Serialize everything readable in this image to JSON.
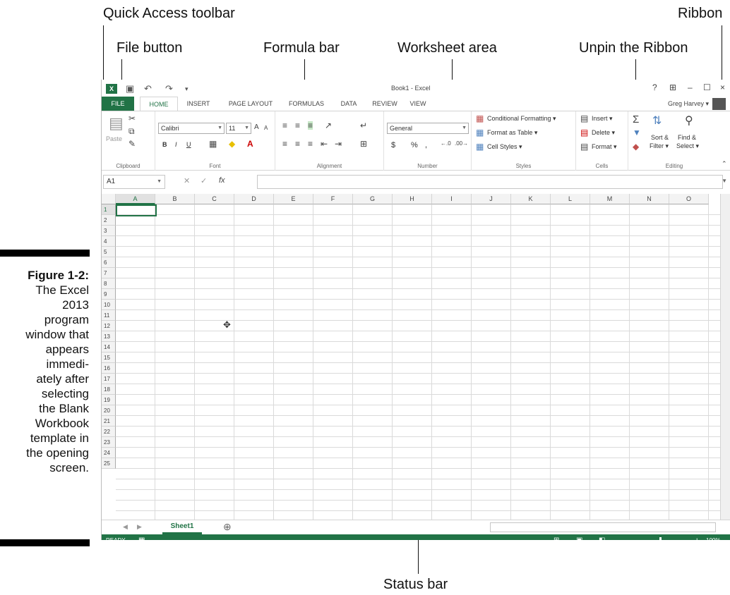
{
  "callouts": {
    "quick_access": "Quick Access toolbar",
    "ribbon": "Ribbon",
    "file_button": "File button",
    "formula_bar": "Formula bar",
    "worksheet_area": "Worksheet area",
    "unpin_ribbon": "Unpin the Ribbon",
    "status_bar": "Status bar"
  },
  "caption": {
    "label": "Figure 1-2:",
    "lines": [
      "The Excel",
      "2013",
      "program",
      "window that",
      "appears",
      "immedi-",
      "ately after",
      "selecting",
      "the Blank",
      "Workbook",
      "template in",
      "the opening",
      "screen."
    ]
  },
  "excel": {
    "logo": "X",
    "title": "Book1 - Excel",
    "window_buttons": [
      "?",
      "⊞",
      "–",
      "☐",
      "×"
    ],
    "user": "Greg Harvey ▾",
    "tabs": [
      "FILE",
      "HOME",
      "INSERT",
      "PAGE LAYOUT",
      "FORMULAS",
      "DATA",
      "REVIEW",
      "VIEW"
    ],
    "ribbon": {
      "clipboard": {
        "label": "Clipboard",
        "paste": "Paste"
      },
      "font": {
        "label": "Font",
        "name": "Calibri",
        "size": "11",
        "bold": "B",
        "italic": "I",
        "underline": "U"
      },
      "alignment": {
        "label": "Alignment"
      },
      "number": {
        "label": "Number",
        "format": "General",
        "currency": "$",
        "percent": "%",
        "comma": ","
      },
      "styles": {
        "label": "Styles",
        "conditional": "Conditional Formatting ▾",
        "table": "Format as Table ▾",
        "cell_styles": "Cell Styles ▾"
      },
      "cells": {
        "label": "Cells",
        "insert": "Insert ▾",
        "delete": "Delete ▾",
        "format": "Format ▾"
      },
      "editing": {
        "label": "Editing",
        "sort": "Sort &",
        "sort2": "Filter ▾",
        "find": "Find &",
        "find2": "Select ▾"
      }
    },
    "namebox": "A1",
    "fx": "fx",
    "columns": [
      "A",
      "B",
      "C",
      "D",
      "E",
      "F",
      "G",
      "H",
      "I",
      "J",
      "K",
      "L",
      "M",
      "N",
      "O"
    ],
    "rows": [
      "1",
      "2",
      "3",
      "4",
      "5",
      "6",
      "7",
      "8",
      "9",
      "10",
      "11",
      "12",
      "13",
      "14",
      "15",
      "16",
      "17",
      "18",
      "19",
      "20",
      "21",
      "22",
      "23",
      "24",
      "25"
    ],
    "sheet_tab": "Sheet1",
    "add_sheet": "⊕",
    "status": {
      "ready": "READY",
      "zoom": "100%"
    }
  }
}
